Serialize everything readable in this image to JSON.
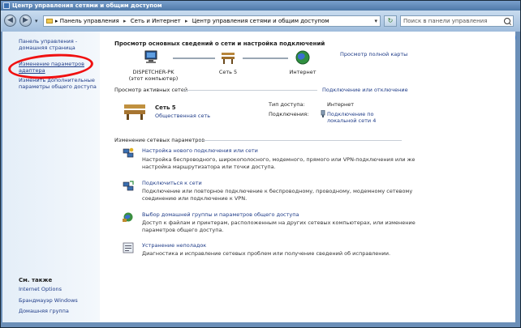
{
  "window": {
    "title": "Центр управления сетями и общим доступом"
  },
  "address": {
    "crumbs": [
      "Панель управления",
      "Сеть и Интернет",
      "Центр управления сетями и общим доступом"
    ],
    "search_placeholder": "Поиск в панели управления"
  },
  "sidebar": {
    "links": [
      "Панель управления - домашняя страница",
      "Изменение параметров адаптера",
      "Изменить дополнительные параметры общего доступа"
    ],
    "see_also_title": "См. также",
    "see_also": [
      "Internet Options",
      "Брандмауэр Windows",
      "Домашняя группа"
    ]
  },
  "main": {
    "title": "Просмотр основных сведений о сети и настройка подключений",
    "map_link": "Просмотр полной карты",
    "map_nodes": [
      {
        "name": "DISPETCHER-PK",
        "sub": "(этот компьютер)"
      },
      {
        "name": "Сеть 5"
      },
      {
        "name": "Интернет"
      }
    ],
    "active_header": "Просмотр активных сетей",
    "connect_link": "Подключение или отключение",
    "network": {
      "name": "Сеть 5",
      "type": "Общественная сеть"
    },
    "access_label": "Тип доступа:",
    "access_value": "Интернет",
    "connections_label": "Подключения:",
    "connections_value": "Подключение по локальной сети 4",
    "change_header": "Изменение сетевых параметров",
    "tasks": [
      {
        "title": "Настройка нового подключения или сети",
        "desc": "Настройка беспроводного, широкополосного, модемного, прямого или VPN-подключения или же настройка маршрутизатора или точки доступа.",
        "icon": "new-connection-icon"
      },
      {
        "title": "Подключиться к сети",
        "desc": "Подключение или повторное подключение к беспроводному, проводному, модемному сетевому соединению или подключение к VPN.",
        "icon": "connect-network-icon"
      },
      {
        "title": "Выбор домашней группы и параметров общего доступа",
        "desc": "Доступ к файлам и принтерам, расположенным на других сетевых компьютерах, или изменение параметров общего доступа.",
        "icon": "homegroup-icon"
      },
      {
        "title": "Устранение неполадок",
        "desc": "Диагностика и исправление сетевых проблем или получение сведений об исправлении.",
        "icon": "troubleshoot-icon"
      }
    ]
  },
  "colors": {
    "link": "#1f3c88",
    "highlight_circle": "#f01010"
  }
}
